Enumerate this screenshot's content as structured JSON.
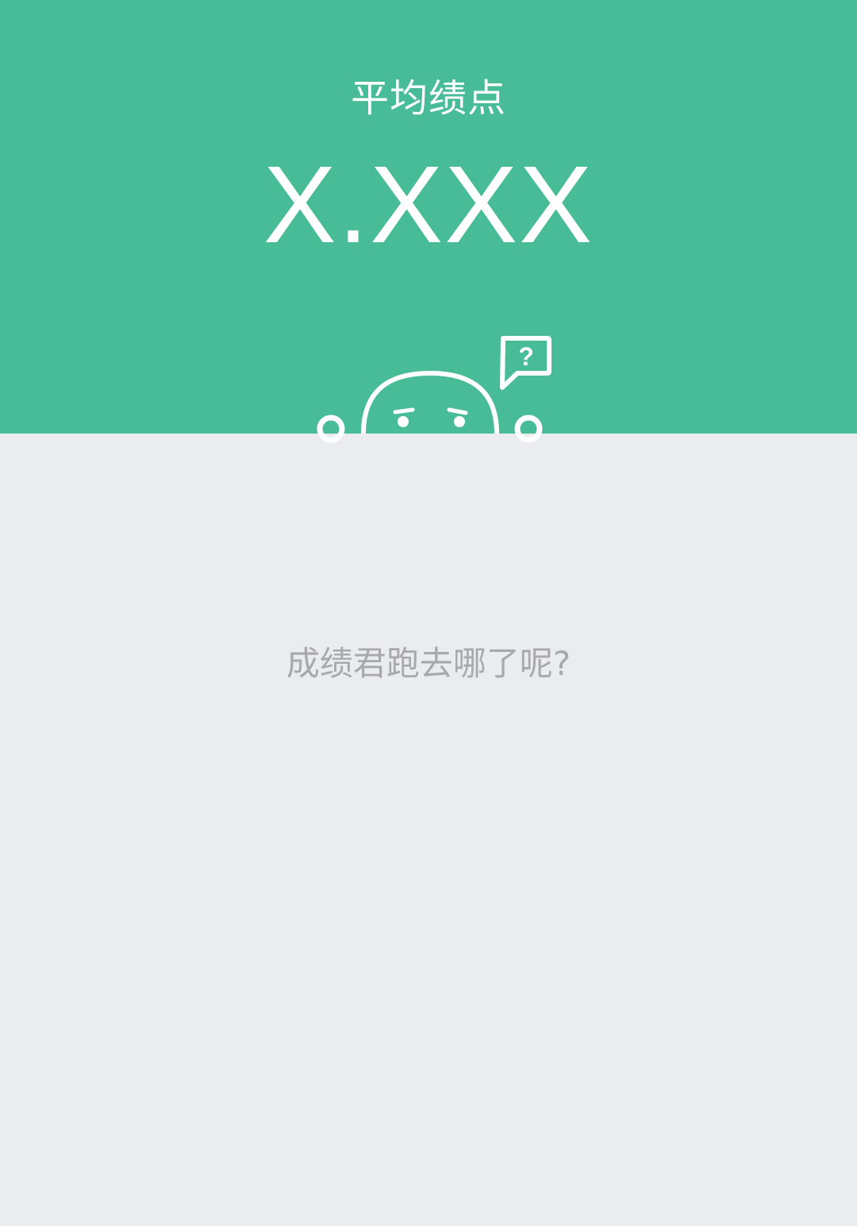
{
  "header": {
    "gpa_label": "平均绩点",
    "gpa_value": "X.XXX",
    "background_color": "#48bb97",
    "mascot": {
      "icon": "confused-face-peeking-icon",
      "speech_bubble_text": "?"
    }
  },
  "main": {
    "background_color": "#ebecf0",
    "empty_message": "成绩君跑去哪了呢?"
  }
}
